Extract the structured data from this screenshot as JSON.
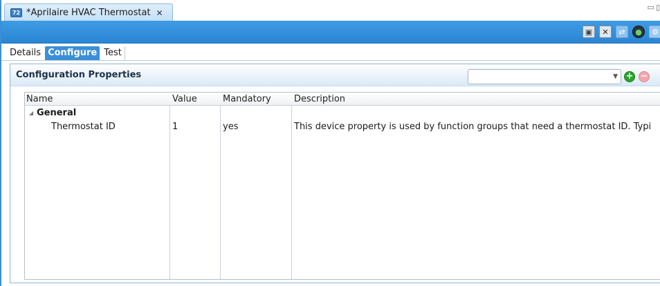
{
  "editor": {
    "tab_icon": "thermostat-app-icon",
    "tab_icon_text": "72",
    "tab_title": "*Aprilaire HVAC Thermostat",
    "close_glyph": "✕"
  },
  "toolbar": {
    "icons": [
      "save-icon",
      "save-close-icon",
      "device-link-icon",
      "device-status-icon",
      "config-icon"
    ]
  },
  "page_tabs": [
    {
      "label": "Details",
      "active": false
    },
    {
      "label": "Configure",
      "active": true
    },
    {
      "label": "Test",
      "active": false
    }
  ],
  "section": {
    "title": "Configuration Properties",
    "combo_value": "",
    "add_glyph": "+",
    "remove_glyph": "−"
  },
  "table": {
    "columns": [
      "Name",
      "Value",
      "Mandatory",
      "Description"
    ],
    "group": {
      "label": "General",
      "expanded": true
    },
    "rows": [
      {
        "name": "Thermostat ID",
        "value": "1",
        "mandatory": "yes",
        "description": "This device property is used by function groups that need a thermostat ID. Typi"
      }
    ]
  },
  "colors": {
    "accent": "#3a8fd9",
    "toolbar": "#2a86d4",
    "add": "#2aa52a",
    "remove": "#f3a6ad"
  }
}
